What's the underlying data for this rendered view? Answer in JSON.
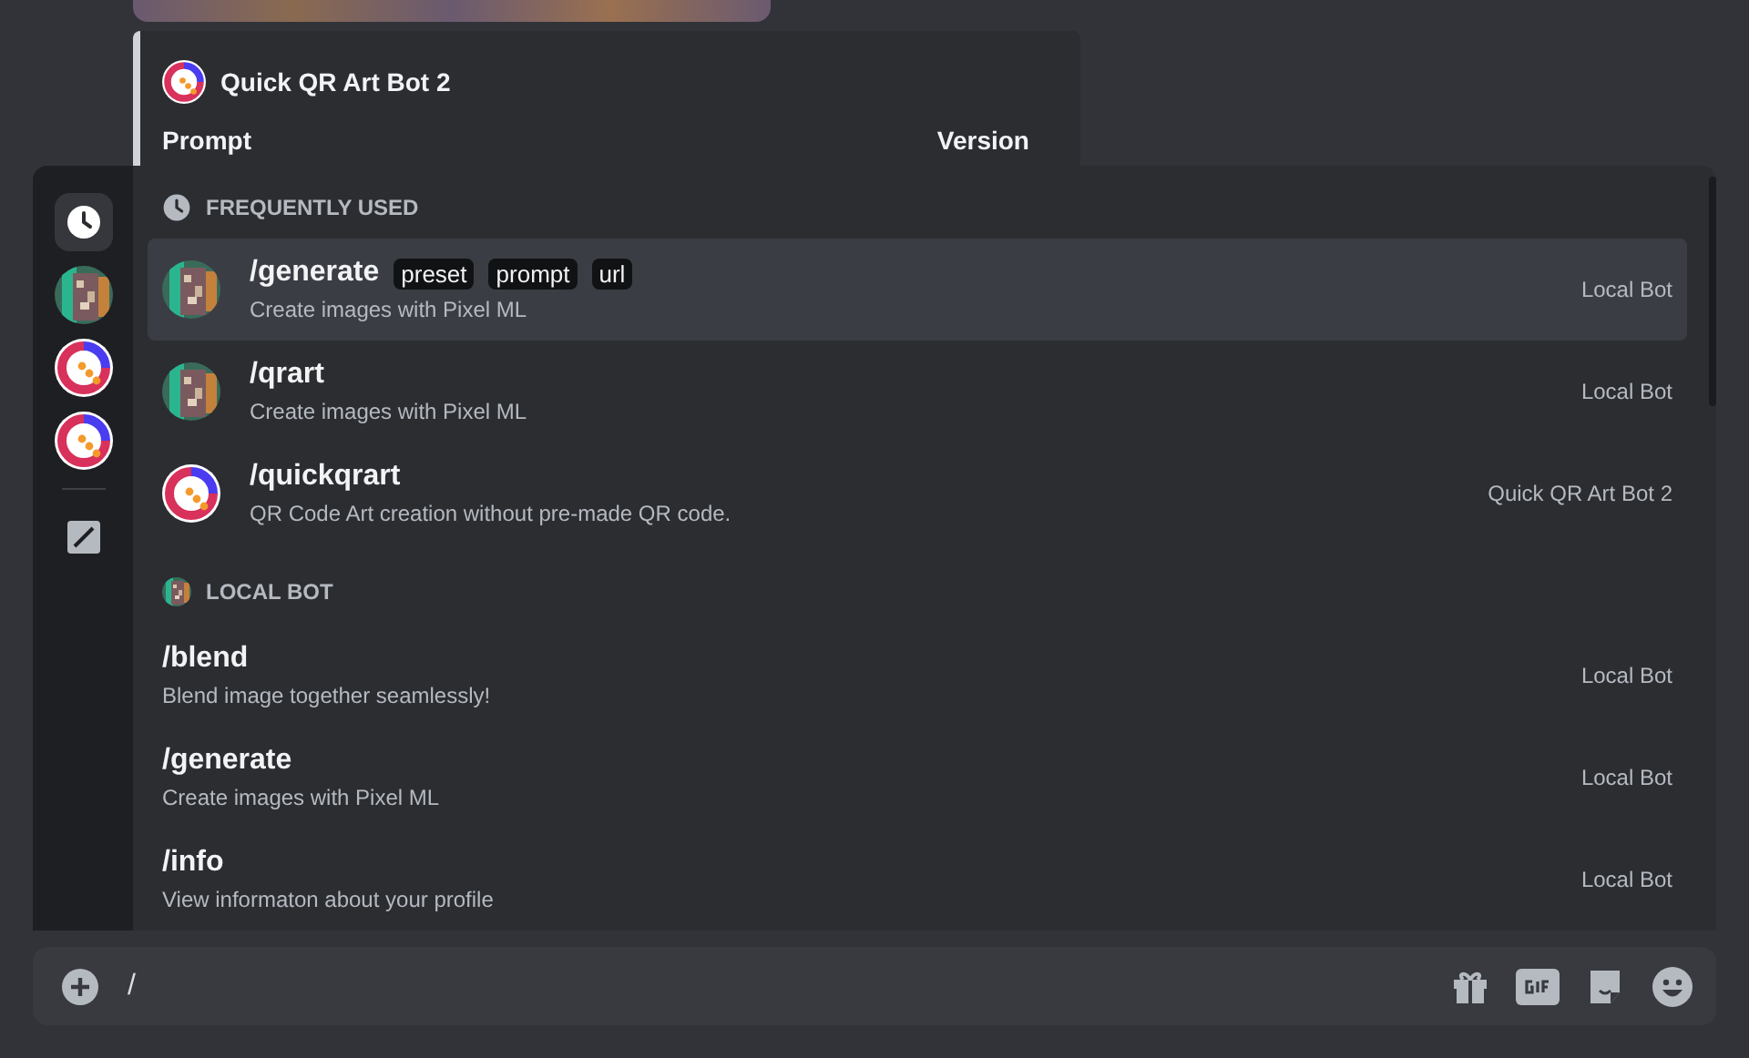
{
  "embed": {
    "bot_name": "Quick QR Art Bot 2",
    "fields": [
      {
        "label": "Prompt"
      },
      {
        "label": "Version"
      }
    ]
  },
  "rail": [
    {
      "kind": "clock",
      "selected": true
    },
    {
      "kind": "pixel",
      "selected": false
    },
    {
      "kind": "qr",
      "selected": false
    },
    {
      "kind": "qr",
      "selected": false
    },
    {
      "kind": "pencil",
      "selected": false
    }
  ],
  "sections": [
    {
      "title": "FREQUENTLY USED",
      "kind": "recent",
      "items": [
        {
          "name": "/generate",
          "options": [
            "preset",
            "prompt",
            "url"
          ],
          "description": "Create images with Pixel ML",
          "source": "Local Bot",
          "kind": "pixel",
          "selected": true
        },
        {
          "name": "/qrart",
          "description": "Create images with Pixel ML",
          "source": "Local Bot",
          "kind": "pixel",
          "selected": false
        },
        {
          "name": "/quickqrart",
          "description": "QR Code Art creation without pre-made QR code.",
          "source": "Quick QR Art Bot 2",
          "kind": "qr",
          "selected": false
        }
      ]
    },
    {
      "title": "LOCAL BOT",
      "kind": "bot",
      "items": [
        {
          "name": "/blend",
          "description": "Blend image together seamlessly!",
          "source": "Local Bot",
          "kind": "plain",
          "selected": false
        },
        {
          "name": "/generate",
          "description": "Create images with Pixel ML",
          "source": "Local Bot",
          "kind": "plain",
          "selected": false
        },
        {
          "name": "/info",
          "description": "View informaton about your profile",
          "source": "Local Bot",
          "kind": "plain",
          "selected": false
        }
      ]
    }
  ],
  "composer": {
    "value": "/"
  }
}
